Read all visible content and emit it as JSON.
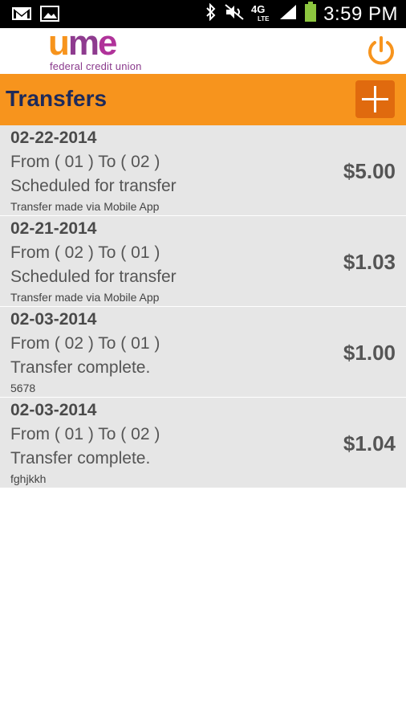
{
  "status_bar": {
    "time": "3:59 PM",
    "network": "4G LTE",
    "icons": [
      "gmail-icon",
      "image-icon",
      "bluetooth-icon",
      "mute-icon",
      "signal-icon",
      "battery-icon"
    ]
  },
  "header": {
    "logo_word": {
      "u": "u",
      "m": "m",
      "e": "e"
    },
    "logo_tagline": "federal credit union",
    "power_icon": "power-icon"
  },
  "titlebar": {
    "title": "Transfers",
    "add_icon": "plus-icon"
  },
  "colors": {
    "accent": "#f7941d",
    "title_text": "#1e2a5a",
    "add_button": "#e06a0e",
    "row_bg": "#e6e6e6"
  },
  "transfers": [
    {
      "date": "02-22-2014",
      "from_to": "From ( 01 ) To ( 02 )",
      "status": "Scheduled for transfer",
      "memo": "Transfer made via Mobile App",
      "amount": "$5.00"
    },
    {
      "date": "02-21-2014",
      "from_to": "From ( 02 ) To ( 01 )",
      "status": "Scheduled for transfer",
      "memo": "Transfer made via Mobile App",
      "amount": "$1.03"
    },
    {
      "date": "02-03-2014",
      "from_to": "From ( 02 ) To ( 01 )",
      "status": "Transfer complete.",
      "memo": "5678",
      "amount": "$1.00"
    },
    {
      "date": "02-03-2014",
      "from_to": "From ( 01 ) To ( 02 )",
      "status": "Transfer complete.",
      "memo": "fghjkkh",
      "amount": "$1.04"
    }
  ]
}
